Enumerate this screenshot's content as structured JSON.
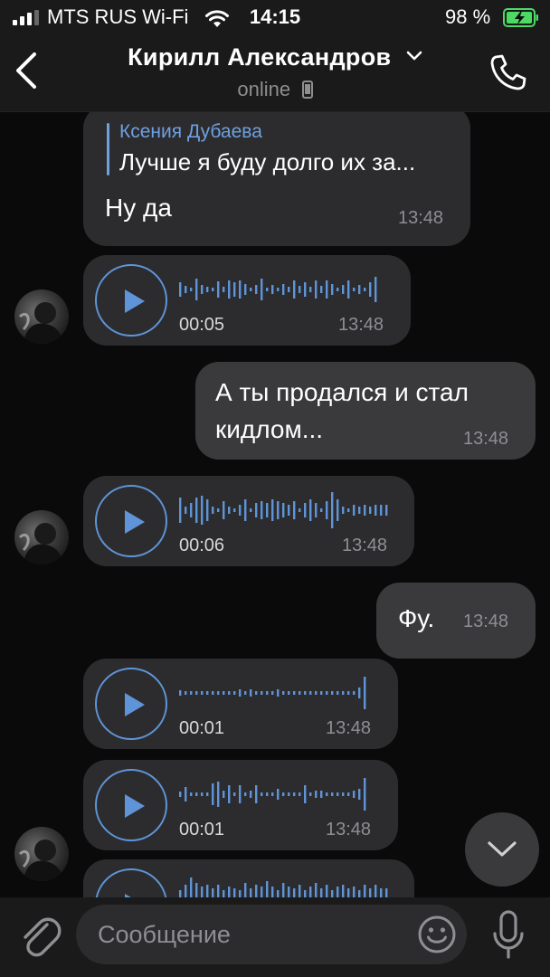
{
  "status_bar": {
    "carrier": "MTS RUS Wi-Fi",
    "time": "14:15",
    "battery": "98 %"
  },
  "header": {
    "title": "Кирилл Александров",
    "status": "online",
    "icons": [
      "back-arrow-icon",
      "chevron-down-icon",
      "mobile-device-icon",
      "phone-call-icon"
    ]
  },
  "messages": [
    {
      "type": "text-reply",
      "direction": "in",
      "reply_author": "Ксения Дубаева",
      "reply_text": "Лучше я буду долго их за...",
      "text": "Ну да",
      "time": "13:48"
    },
    {
      "type": "voice",
      "direction": "in",
      "duration": "00:05",
      "time": "13:48"
    },
    {
      "type": "text",
      "direction": "out",
      "text_line1": "А ты продался и стал",
      "text_line2": "кидлом...",
      "time": "13:48"
    },
    {
      "type": "voice",
      "direction": "in",
      "duration": "00:06",
      "time": "13:48"
    },
    {
      "type": "text",
      "direction": "out",
      "text": "Фу.",
      "time": "13:48"
    },
    {
      "type": "voice",
      "direction": "in",
      "duration": "00:01",
      "time": "13:48"
    },
    {
      "type": "voice",
      "direction": "in",
      "duration": "00:01",
      "time": "13:48"
    },
    {
      "type": "voice",
      "direction": "in",
      "duration": "",
      "time": ""
    }
  ],
  "input": {
    "placeholder": "Сообщение",
    "icons": [
      "paperclip-icon",
      "emoji-icon",
      "microphone-icon"
    ]
  },
  "colors": {
    "accent": "#5f95d8",
    "incoming_bubble": "#2c2c2e",
    "outgoing_bubble": "#3a3a3c",
    "background": "#0a0a0a",
    "battery_green": "#4cd964"
  }
}
